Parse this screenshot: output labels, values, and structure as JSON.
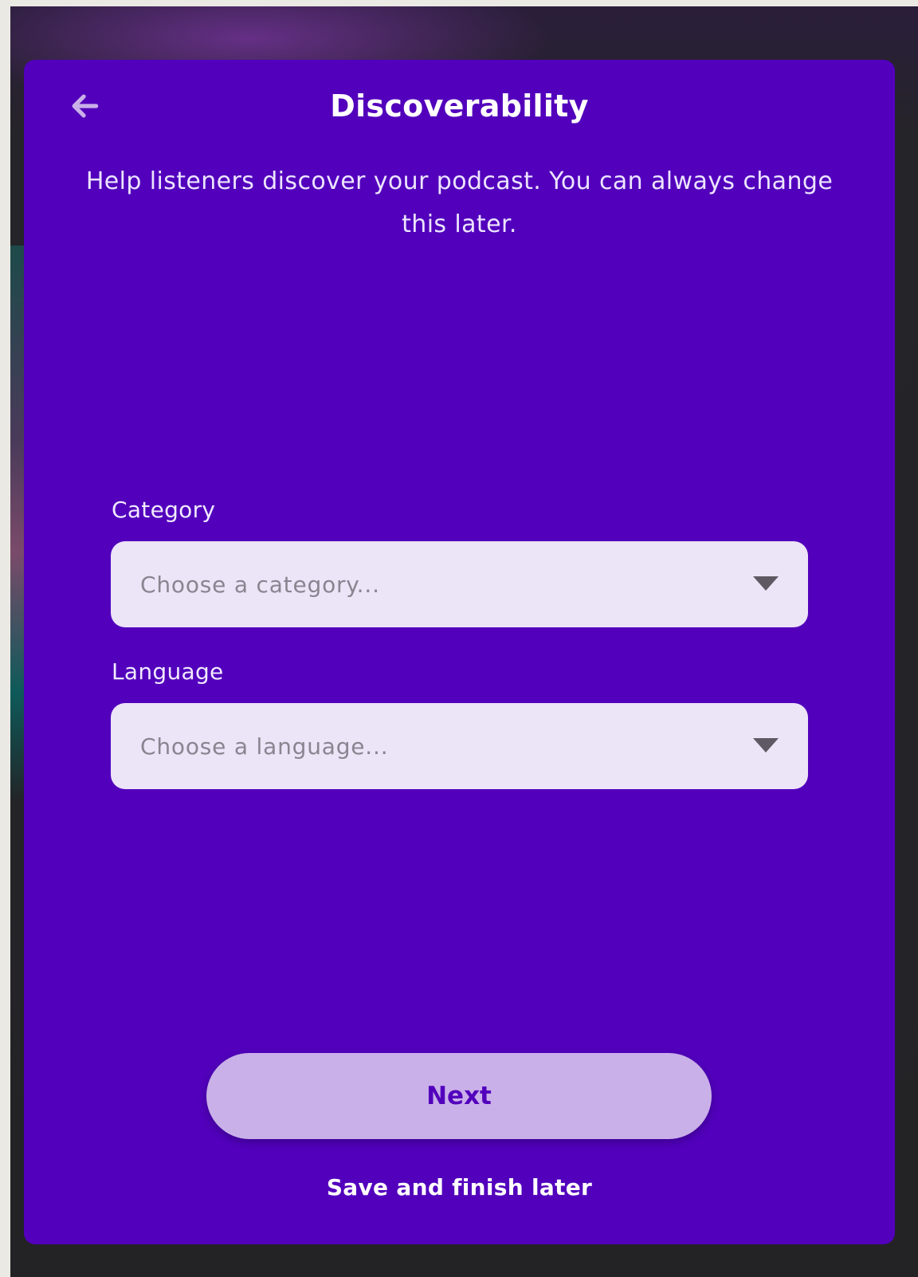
{
  "header": {
    "title": "Discoverability",
    "back_icon": "arrow-left-icon"
  },
  "intro": {
    "text": "Help listeners discover your podcast. You can always change this later."
  },
  "form": {
    "category": {
      "label": "Category",
      "placeholder": "Choose a category...",
      "icon": "caret-down-icon"
    },
    "language": {
      "label": "Language",
      "placeholder": "Choose a language...",
      "icon": "caret-down-icon"
    }
  },
  "actions": {
    "next_label": "Next",
    "save_later_label": "Save and finish later"
  },
  "colors": {
    "card_background": "#5200bc",
    "select_background": "#ece4f7",
    "primary_button": "#c9b0e9",
    "primary_button_text": "#5200bc",
    "back_icon": "#c9b0e9"
  }
}
